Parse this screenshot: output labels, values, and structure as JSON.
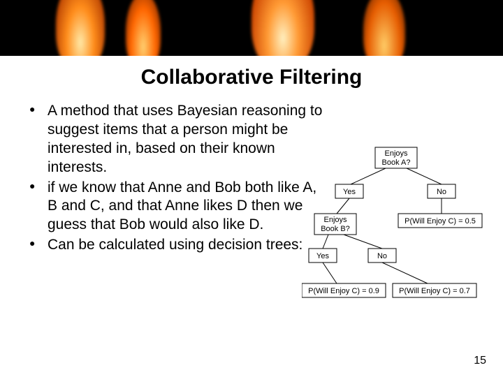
{
  "banner": {
    "alt": "flame-graphic"
  },
  "title": "Collaborative Filtering",
  "bullets": [
    "A method that uses Bayesian reasoning to suggest items that a person might be interested in, based on their known interests.",
    "if we know that Anne and Bob both like A, B and C, and that Anne likes D then we guess that Bob would also like D.",
    "Can be calculated using decision trees:"
  ],
  "diagram": {
    "nodes": {
      "rootA": {
        "line1": "Enjoys",
        "line2": "Book A?"
      },
      "rootB": {
        "line1": "Enjoys",
        "line2": "Book B?"
      },
      "yes": "Yes",
      "no": "No"
    },
    "leaves": {
      "p05": "P(Will Enjoy C) = 0.5",
      "p09": "P(Will Enjoy C) = 0.9",
      "p07": "P(Will Enjoy C) = 0.7"
    }
  },
  "page_number": "15"
}
